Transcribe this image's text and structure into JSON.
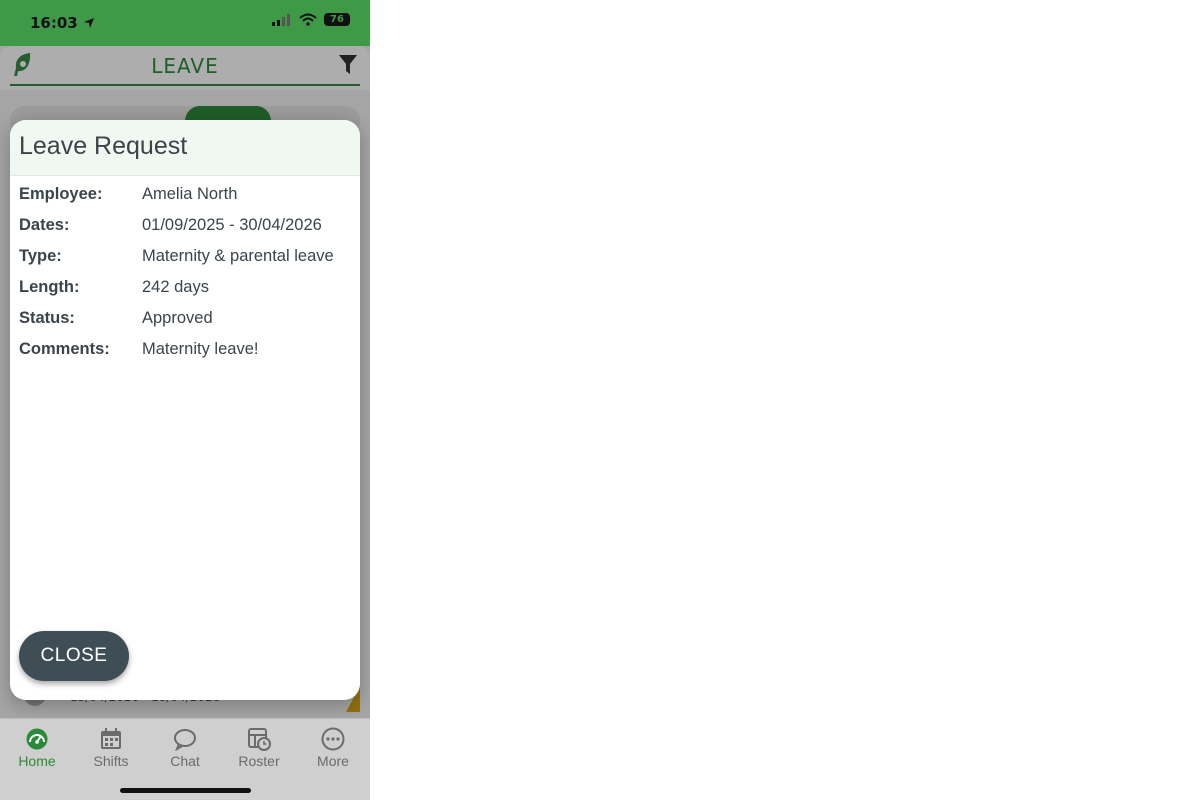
{
  "status_bar": {
    "time": "16:03",
    "battery": "76"
  },
  "header": {
    "title": "LEAVE"
  },
  "modal": {
    "title": "Leave Request",
    "fields": [
      {
        "label": "Employee:",
        "value": "Amelia North"
      },
      {
        "label": "Dates:",
        "value": "01/09/2025 - 30/04/2026"
      },
      {
        "label": "Type:",
        "value": "Maternity & parental leave"
      },
      {
        "label": "Length:",
        "value": "242 days"
      },
      {
        "label": "Status:",
        "value": "Approved"
      },
      {
        "label": "Comments:",
        "value": "Maternity leave!"
      }
    ],
    "close_label": "CLOSE"
  },
  "background_item": {
    "dates": "13/04/2026 - 18/04/2026"
  },
  "tabbar": {
    "items": [
      {
        "label": "Home",
        "icon": "speedometer-icon"
      },
      {
        "label": "Shifts",
        "icon": "calendar-icon"
      },
      {
        "label": "Chat",
        "icon": "chat-bubble-icon"
      },
      {
        "label": "Roster",
        "icon": "roster-clock-icon"
      },
      {
        "label": "More",
        "icon": "ellipsis-circle-icon"
      }
    ]
  },
  "colors": {
    "brand_green": "#2e8b3b",
    "status_bar": "#3f9a47",
    "button_dark": "#3f4d55"
  }
}
